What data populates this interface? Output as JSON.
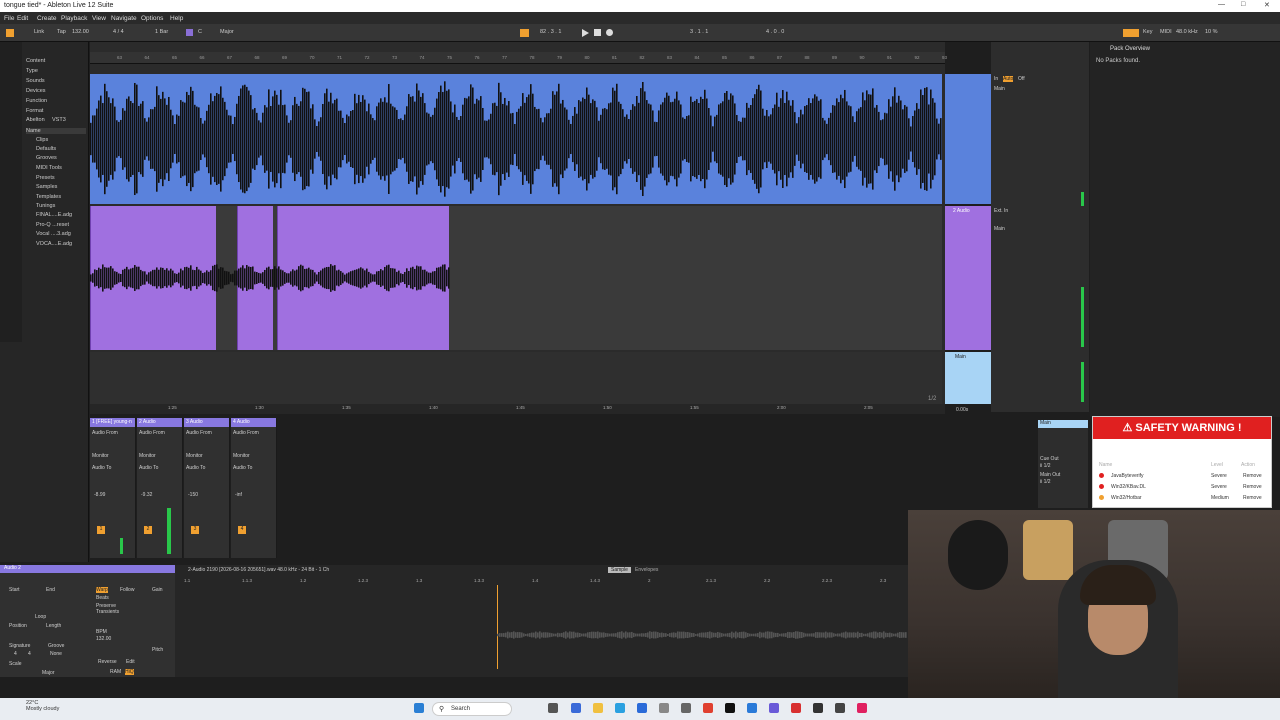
{
  "window": {
    "title": "tongue tied* - Ableton Live 12 Suite"
  },
  "menu": {
    "items": [
      "File",
      "Edit",
      "Create",
      "Playback",
      "View",
      "Navigate",
      "Options",
      "Help"
    ]
  },
  "controlbar": {
    "link": "Link",
    "tap": "Tap",
    "tempo": "132.00",
    "signature": "4 / 4",
    "quantize": "1 Bar",
    "key_root": "C",
    "scale": "Major",
    "position": "82 . 3 . 1",
    "loop_start": "3 . 1 . 1",
    "loop_len": "4 . 0 . 0",
    "key_label": "Key",
    "midi_label": "MIDI",
    "sample_rate": "48.0 kHz",
    "cpu": "10 %"
  },
  "browser": {
    "categories": [
      "Content",
      "Type",
      "Sounds",
      "Devices",
      "Function",
      "Format",
      "Abelton",
      "VST3"
    ],
    "places_header": "Name",
    "items": [
      "Clips",
      "Defaults",
      "Grooves",
      "MIDI Tools",
      "Presets",
      "Samples",
      "Templates",
      "Tunings",
      "FINAL....E.adg",
      "Pro-Q ...reset",
      "Vocal ....3.adg",
      "VOCA....E.adg"
    ]
  },
  "ruler": {
    "marks": [
      "63",
      "64",
      "65",
      "66",
      "67",
      "68",
      "69",
      "70",
      "71",
      "72",
      "73",
      "74",
      "75",
      "76",
      "77",
      "78",
      "79",
      "80",
      "81",
      "82",
      "83",
      "84",
      "85",
      "86",
      "87",
      "88",
      "89",
      "90",
      "91",
      "92",
      "93"
    ]
  },
  "timeline": {
    "marks": [
      "1:25",
      "1:30",
      "1:35",
      "1:40",
      "1:45",
      "1:50",
      "1:55",
      "2:00",
      "2:05"
    ]
  },
  "tracks": {
    "t2_name": "2 Audio",
    "main_name": "Main",
    "ext_in": "Ext. In",
    "in_label": "In",
    "auto_label": "Auto",
    "off_label": "Off",
    "main_out": "Main",
    "page": "1/2",
    "zoom": "0.00s"
  },
  "mixer": {
    "columns": [
      {
        "name": "1 [FREE] young-n",
        "num": "1",
        "vol": "-8.99"
      },
      {
        "name": "2 Audio",
        "num": "2",
        "vol": "-9.32"
      },
      {
        "name": "3 Audio",
        "num": "3",
        "vol": "-150"
      },
      {
        "name": "4 Audio",
        "num": "4",
        "vol": "-inf"
      }
    ],
    "audio_from": "Audio From",
    "audio_to": "Audio To",
    "monitor": "Monitor",
    "cue_out": "Cue Out",
    "main_out": "Main Out",
    "cue_val": "ii 1/2",
    "main_val": "ii 1/2"
  },
  "rightpanel": {
    "title": "Pack Overview",
    "empty": "No Packs found."
  },
  "clipview": {
    "clip_name": "Audio 2",
    "file": "2-Audio 2190 [2026-08-16 205651].wav  48.0 kHz - 24 Bit - 1 Ch",
    "tab_sample": "Sample",
    "tab_env": "Envelopes",
    "start": "Start",
    "end": "End",
    "loop": "Loop",
    "position": "Position",
    "length": "Length",
    "signature": "Signature",
    "groove": "Groove",
    "scale": "Scale",
    "warp": "Warp",
    "follow": "Follow",
    "beats": "Beats",
    "preserve": "Preserve",
    "transients": "Transients",
    "bpm": "BPM",
    "bpm_val": "132.00",
    "gain": "Gain",
    "reverse": "Reverse",
    "edit": "Edit",
    "ram": "RAM",
    "hiq": "HiQ",
    "pitch": "Pitch",
    "none": "None",
    "major": "Major",
    "sig_num": "4",
    "sig_den": "4",
    "ruler": [
      "1.1",
      "1.1.3",
      "1.2",
      "1.2.3",
      "1.3",
      "1.3.3",
      "1.4",
      "1.4.3",
      "2",
      "2.1.3",
      "2.2",
      "2.2.3",
      "2.3"
    ]
  },
  "warning": {
    "title": "SAFETY WARNING !",
    "col_name": "Name",
    "col_level": "Level",
    "col_action": "Action",
    "rows": [
      {
        "name": "JavaByteverify",
        "level": "Severe",
        "action": "Remove"
      },
      {
        "name": "Win32/KBav.DL",
        "level": "Severe",
        "action": "Remove"
      },
      {
        "name": "Win32/Hotbar",
        "level": "Medium",
        "action": "Remove"
      }
    ]
  },
  "taskbar": {
    "temp": "22°C",
    "weather": "Mostly cloudy",
    "search": "Search"
  },
  "colors": {
    "clip_blue": "#5a82dc",
    "clip_purple": "#a070e0",
    "warning_red": "#e02020",
    "accent_orange": "#f0a030"
  }
}
